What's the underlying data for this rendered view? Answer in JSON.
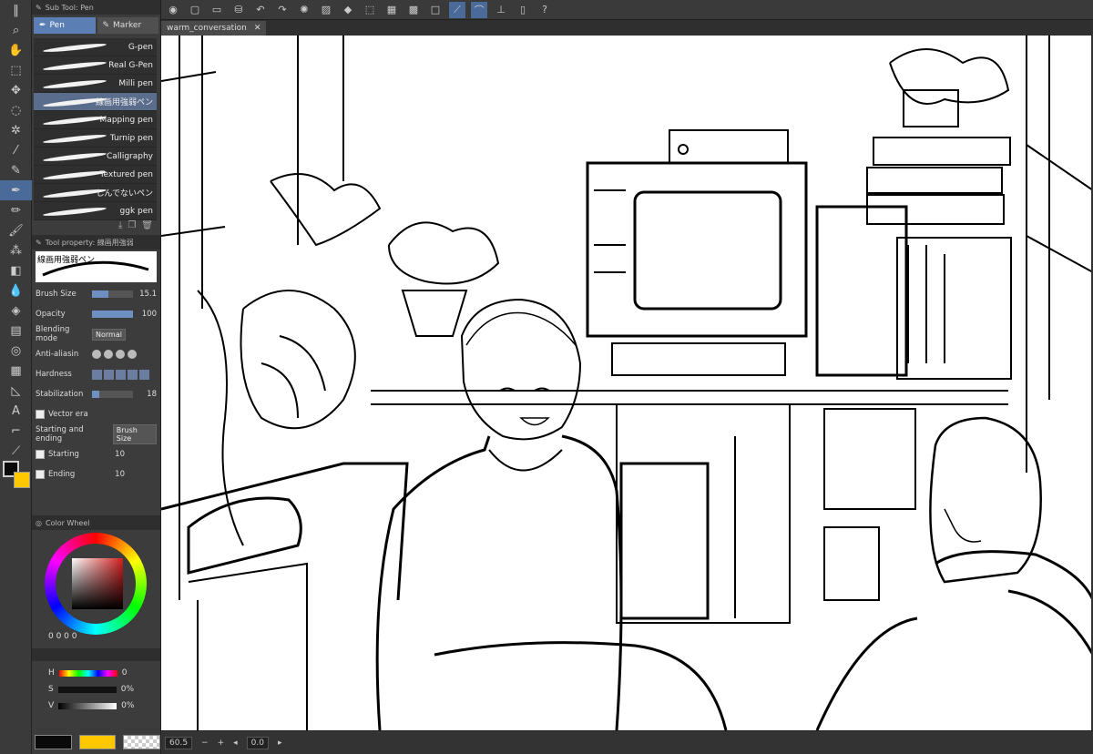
{
  "colors": {
    "accent": "#5b7fb5",
    "fg": "#0a0a0a",
    "bg": "#ffc800"
  },
  "subtool": {
    "title": "Sub Tool: Pen",
    "tabs": [
      "Pen",
      "Marker"
    ],
    "brushes": [
      "G-pen",
      "Real G-Pen",
      "Milli pen",
      "線画用強弱ペン",
      "Mapping pen",
      "Turnip pen",
      "Calligraphy",
      "Textured pen",
      "しんでないペン",
      "ggk pen"
    ],
    "active_index": 3
  },
  "toolprop": {
    "title": "Tool property: 線画用強弱",
    "preview_label": "線画用強弱ペン",
    "brush_size_label": "Brush Size",
    "brush_size": "15.1",
    "opacity_label": "Opacity",
    "opacity": "100",
    "blending_label": "Blending mode",
    "blending_value": "Normal",
    "antialias_label": "Anti-aliasin",
    "hardness_label": "Hardness",
    "stabilization_label": "Stabilization",
    "stabilization": "18",
    "vector_label": "Vector era",
    "start_end_label": "Starting and ending",
    "start_end_value": "Brush Size",
    "starting_label": "Starting",
    "starting": "10",
    "ending_label": "Ending",
    "ending": "10"
  },
  "colorwheel": {
    "title": "Color Wheel",
    "values": "0  0  0  0"
  },
  "sliders": {
    "tabs_side": "RGB HSV CMY",
    "h_label": "H",
    "h": "0",
    "s_label": "S",
    "s": "0%",
    "v_label": "V",
    "v": "0%"
  },
  "document": {
    "tab": "warm_conversation"
  },
  "status": {
    "zoom": "60.5",
    "angle": "0.0"
  }
}
